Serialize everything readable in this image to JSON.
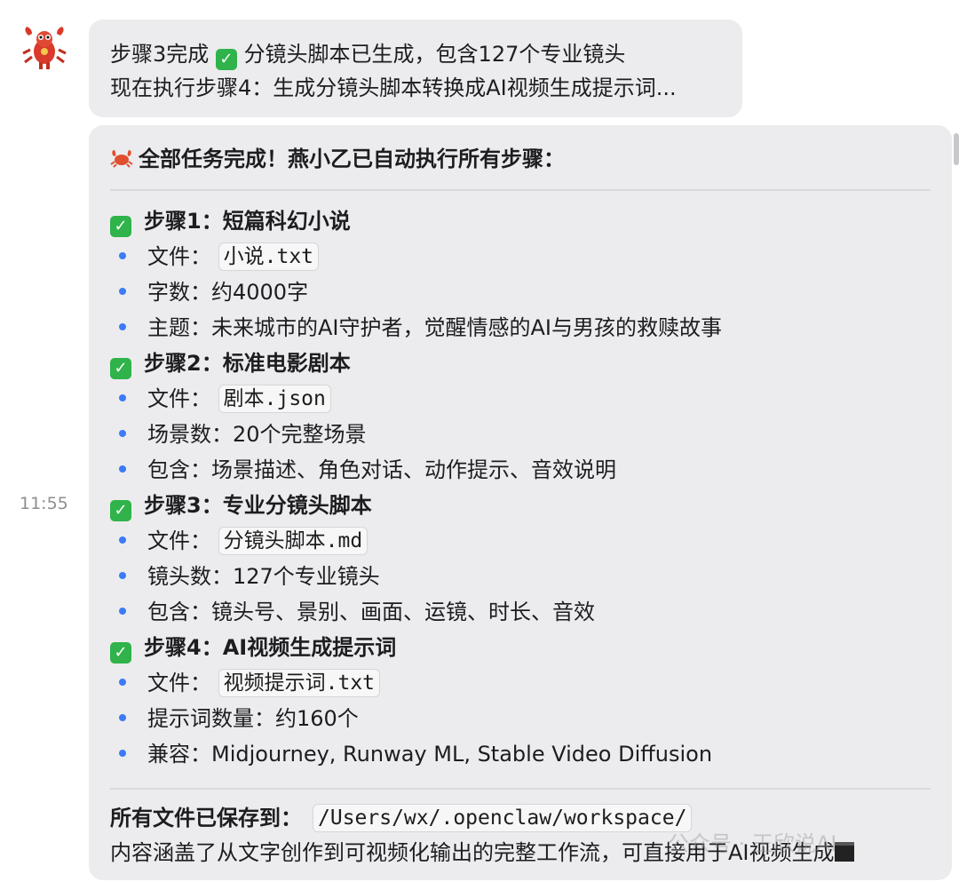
{
  "timestamp": "11:55",
  "message1": {
    "line1_prefix": "步骤3完成",
    "line1_suffix": "分镜头脚本已生成，包含127个专业镜头",
    "line2": "现在执行步骤4：生成分镜头脚本转换成AI视频生成提示词..."
  },
  "message2": {
    "title": "全部任务完成！燕小乙已自动执行所有步骤：",
    "steps": [
      {
        "title": "步骤1：短篇科幻小说",
        "file_label": "文件：",
        "file": "小说.txt",
        "details": [
          "字数：约4000字",
          "主题：未来城市的AI守护者，觉醒情感的AI与男孩的救赎故事"
        ]
      },
      {
        "title": "步骤2：标准电影剧本",
        "file_label": "文件：",
        "file": "剧本.json",
        "details": [
          "场景数：20个完整场景",
          "包含：场景描述、角色对话、动作提示、音效说明"
        ]
      },
      {
        "title": "步骤3：专业分镜头脚本",
        "file_label": "文件：",
        "file": "分镜头脚本.md",
        "details": [
          "镜头数：127个专业镜头",
          "包含：镜头号、景别、画面、运镜、时长、音效"
        ]
      },
      {
        "title": "步骤4：AI视频生成提示词",
        "file_label": "文件：",
        "file": "视频提示词.txt",
        "details": [
          "提示词数量：约160个",
          "兼容：Midjourney, Runway ML, Stable Video Diffusion"
        ]
      }
    ],
    "saved_label": "所有文件已保存到：",
    "saved_path": "/Users/wx/.openclaw/workspace/",
    "footer": "内容涵盖了从文字创作到可视频化输出的完整工作流，可直接用于AI视频生成"
  },
  "watermark": "公众号 · 王欣说AI",
  "colors": {
    "bubble": "#ececee",
    "check": "#2fb34a",
    "bullet": "#3b7bf5"
  }
}
